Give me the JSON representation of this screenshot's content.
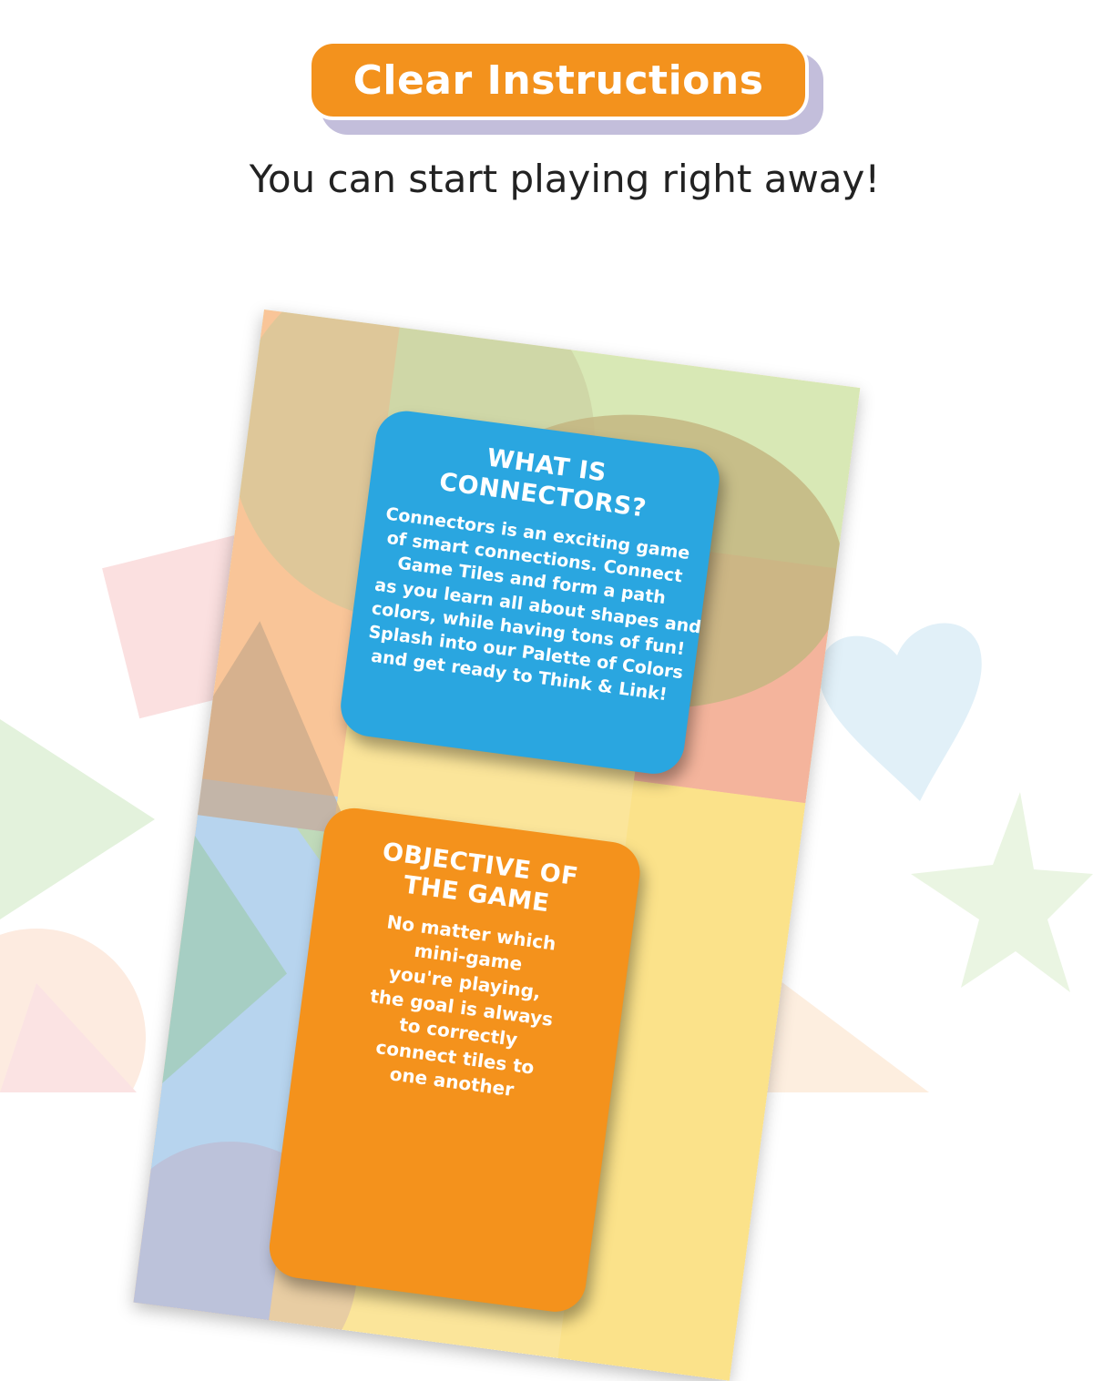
{
  "header": {
    "pill_label": "Clear Instructions",
    "subtitle": "You can start playing right away!"
  },
  "cards": [
    {
      "title_lines": [
        "WHAT IS",
        "CONNECTORS?"
      ],
      "body_lines": [
        "Connectors is an exciting game",
        "of smart connections. Connect",
        "Game Tiles and form a path",
        "as you learn all about shapes and",
        "colors, while having tons of fun!",
        "Splash into our Palette of Colors",
        "and get ready to Think & Link!"
      ]
    },
    {
      "title_lines": [
        "OBJECTIVE OF",
        "THE GAME"
      ],
      "body_lines": [
        "No matter which",
        "mini-game",
        "you're playing,",
        "the goal is always",
        "to correctly",
        "connect tiles to",
        "one another"
      ]
    }
  ],
  "colors": {
    "accent_orange": "#f3921d",
    "card_blue": "#2aa6e0",
    "card_orange": "#f4921c",
    "pill_shadow": "#c3bedb"
  }
}
